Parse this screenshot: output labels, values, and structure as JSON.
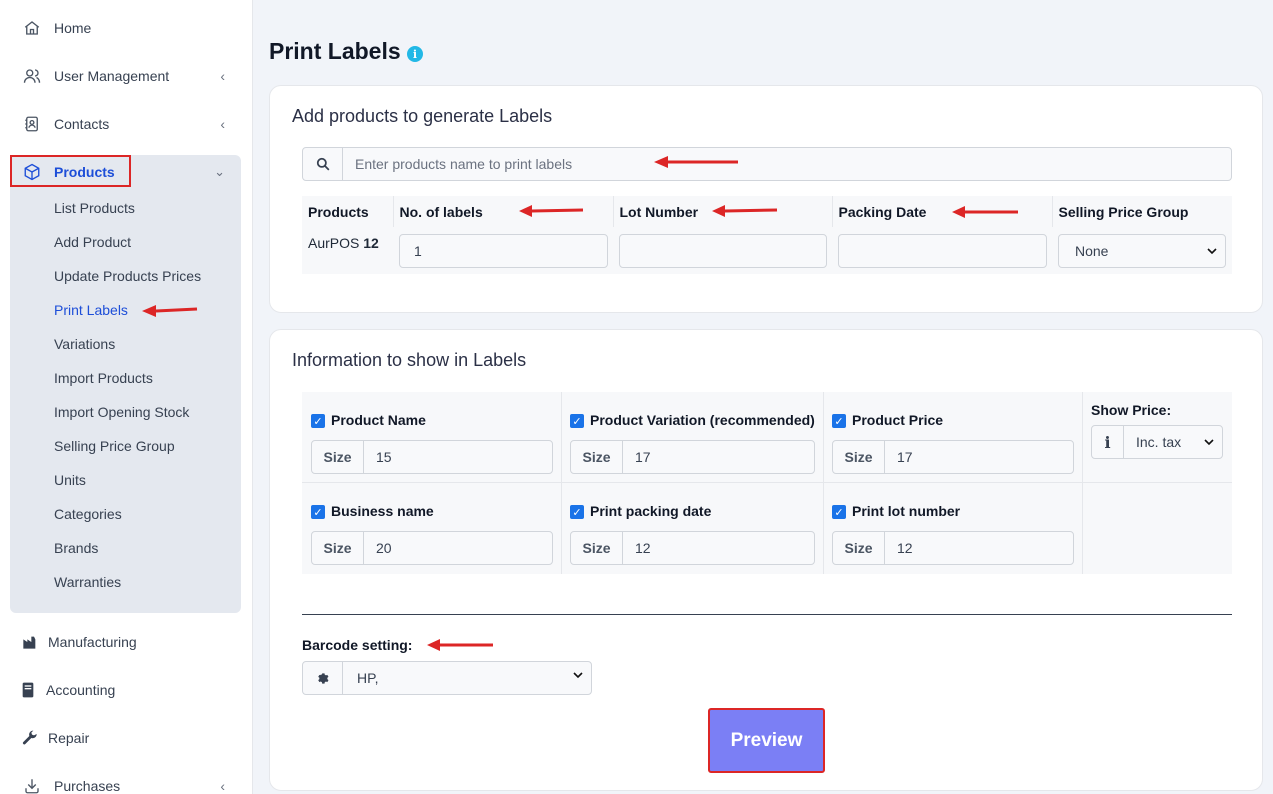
{
  "sidebar": {
    "items": [
      {
        "label": "Home",
        "icon": "home-icon"
      },
      {
        "label": "User Management",
        "icon": "users-icon"
      },
      {
        "label": "Contacts",
        "icon": "contacts-icon"
      },
      {
        "label": "Products",
        "icon": "box-icon"
      },
      {
        "label": "Manufacturing",
        "icon": "factory-icon"
      },
      {
        "label": "Accounting",
        "icon": "book-icon"
      },
      {
        "label": "Repair",
        "icon": "wrench-icon"
      },
      {
        "label": "Purchases",
        "icon": "download-icon"
      }
    ],
    "products_sub": [
      "List Products",
      "Add Product",
      "Update Products Prices",
      "Print Labels",
      "Variations",
      "Import Products",
      "Import Opening Stock",
      "Selling Price Group",
      "Units",
      "Categories",
      "Brands",
      "Warranties"
    ]
  },
  "page": {
    "title": "Print Labels",
    "info_glyph": "i"
  },
  "add_card": {
    "title": "Add products to generate Labels",
    "search_placeholder": "Enter products name to print labels",
    "headers": [
      "Products",
      "No. of labels",
      "Lot Number",
      "Packing Date",
      "Selling Price Group"
    ],
    "row": {
      "product_name": "AurPOS",
      "product_sku": "12",
      "labels": "1",
      "lot_number": "",
      "packing_date": "",
      "price_group": "None"
    }
  },
  "info_card": {
    "title": "Information to show in Labels",
    "size_label": "Size",
    "options": [
      {
        "label": "Product Name",
        "size": "15",
        "checked": true
      },
      {
        "label": "Product Variation (recommended)",
        "size": "17",
        "checked": true
      },
      {
        "label": "Product Price",
        "size": "17",
        "checked": true
      },
      {
        "label": "Business name",
        "size": "20",
        "checked": true
      },
      {
        "label": "Print packing date",
        "size": "12",
        "checked": true
      },
      {
        "label": "Print lot number",
        "size": "12",
        "checked": true
      }
    ],
    "show_price_label": "Show Price:",
    "show_price_value": "Inc. tax",
    "barcode_label": "Barcode setting:",
    "barcode_value": "HP,",
    "preview_label": "Preview"
  },
  "colors": {
    "accent": "#1d4ed8",
    "button": "#7b7ff5",
    "highlight": "#dc2626"
  }
}
